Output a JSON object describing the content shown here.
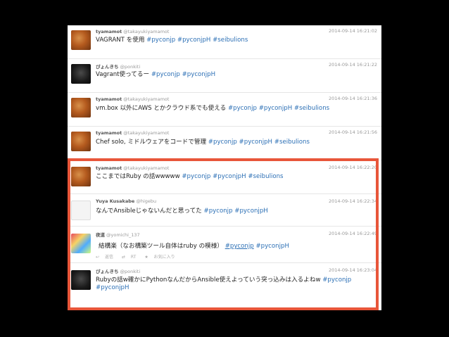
{
  "tweets": [
    {
      "name": "tyamamot",
      "handle": "@takayukiyamamot",
      "time": "2014-09-14 16:21:02",
      "segments": [
        {
          "t": "VAGRANT を使用 "
        },
        {
          "t": "#pyconjp",
          "tag": true
        },
        {
          "t": " "
        },
        {
          "t": "#pyconjpH",
          "tag": true
        },
        {
          "t": " "
        },
        {
          "t": "#seibulions",
          "tag": true
        }
      ]
    },
    {
      "name": "ぴょんきち",
      "handle": "@ponkiti",
      "time": "2014-09-14 16:21:22",
      "segments": [
        {
          "t": "Vagrant使ってるー "
        },
        {
          "t": "#pyconjp",
          "tag": true
        },
        {
          "t": " "
        },
        {
          "t": "#pyconjpH",
          "tag": true
        }
      ]
    },
    {
      "name": "tyamamot",
      "handle": "@takayukiyamamot",
      "time": "2014-09-14 16:21:36",
      "segments": [
        {
          "t": "vm.box 以外にAWS とかクラウド系でも使える "
        },
        {
          "t": "#pyconjp",
          "tag": true
        },
        {
          "t": " "
        },
        {
          "t": "#pyconjpH",
          "tag": true
        },
        {
          "t": " "
        },
        {
          "t": "#seibulions",
          "tag": true
        }
      ]
    },
    {
      "name": "tyamamot",
      "handle": "@takayukiyamamot",
      "time": "2014-09-14 16:21:56",
      "segments": [
        {
          "t": "Chef solo, ミドルウェアをコードで管理 "
        },
        {
          "t": "#pyconjp",
          "tag": true
        },
        {
          "t": " "
        },
        {
          "t": "#pyconjpH",
          "tag": true
        },
        {
          "t": " "
        },
        {
          "t": "#seibulions",
          "tag": true
        }
      ]
    },
    {
      "name": "tyamamot",
      "handle": "@takayukiyamamot",
      "time": "2014-09-14 16:22:20",
      "segments": [
        {
          "t": "ここまではRuby の話wwwww "
        },
        {
          "t": "#pyconjp",
          "tag": true
        },
        {
          "t": " "
        },
        {
          "t": "#pyconjpH",
          "tag": true
        },
        {
          "t": " "
        },
        {
          "t": "#seibulions",
          "tag": true
        }
      ]
    },
    {
      "name": "Yuya Kusakabe",
      "handle": "@higebu",
      "time": "2014-09-14 16:22:34",
      "segments": [
        {
          "t": "なんでAnsibleじゃないんだと思ってた "
        },
        {
          "t": "#pyconjp",
          "tag": true
        },
        {
          "t": " "
        },
        {
          "t": "#pyconjpH",
          "tag": true
        }
      ]
    },
    {
      "name": "夜道",
      "handle": "@yomichi_137",
      "time": "2014-09-14 16:22:49",
      "segments": [
        {
          "t": "結構楽（なお構築ツール自体はruby の模様） "
        },
        {
          "t": "#pyconjp",
          "tag": true,
          "hl": true
        },
        {
          "t": " "
        },
        {
          "t": "#pyconjpH",
          "tag": true
        }
      ],
      "actions": [
        "返信",
        "RT",
        "お気に入り"
      ]
    },
    {
      "name": "ぴょんきち",
      "handle": "@ponkiti",
      "time": "2014-09-14 16:23:04",
      "segments": [
        {
          "t": "Rubyの話w確かにPythonなんだからAnsible使えよっていう突っ込みは入るよねw "
        },
        {
          "t": "#pyconjp",
          "tag": true
        },
        {
          "t": " "
        },
        {
          "t": "#pyconjpH",
          "tag": true
        }
      ]
    }
  ],
  "colors": {
    "background": "#000000",
    "panel": "#ffffff",
    "hashtag": "#2b6fb5",
    "highlight_border": "#e8563a"
  },
  "icons": {
    "reply": "reply-icon",
    "retweet": "retweet-icon",
    "favorite": "star-icon"
  }
}
